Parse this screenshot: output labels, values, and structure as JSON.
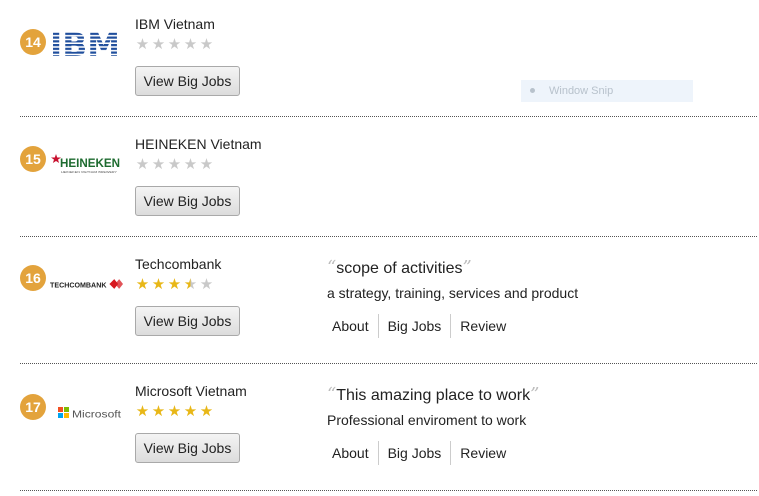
{
  "companies": [
    {
      "rank": "14",
      "name": "IBM Vietnam",
      "rating": 0,
      "button_label": "View Big Jobs",
      "logo_text": "IBM"
    },
    {
      "rank": "15",
      "name": "HEINEKEN Vietnam",
      "rating": 0,
      "button_label": "View Big Jobs",
      "logo_text": "HEINEKEN",
      "logo_subtext": "HEINEKEN VIETNAM BREWERY"
    },
    {
      "rank": "16",
      "name": "Techcombank",
      "rating": 3.5,
      "button_label": "View Big Jobs",
      "logo_text": "TECHCOMBANK",
      "quote": "scope of activities",
      "description": "a strategy, training, services and product",
      "links": [
        "About",
        "Big Jobs",
        "Review"
      ]
    },
    {
      "rank": "17",
      "name": "Microsoft Vietnam",
      "rating": 5,
      "button_label": "View Big Jobs",
      "logo_text": "Microsoft",
      "quote": "This amazing place to work",
      "description": "Professional enviroment to work",
      "links": [
        "About",
        "Big Jobs",
        "Review"
      ]
    }
  ],
  "overlay": {
    "label": "Window Snip"
  },
  "colors": {
    "rank_badge": "#e3a33c",
    "star_full": "#e8b717",
    "star_empty": "#c9c9c9",
    "ibm_blue": "#1f4e9c",
    "heineken_red": "#c8102e",
    "heineken_green": "#1d6b2f"
  },
  "icons": {
    "star": "star-icon",
    "quote_open": "quote-open-icon",
    "quote_close": "quote-close-icon"
  }
}
